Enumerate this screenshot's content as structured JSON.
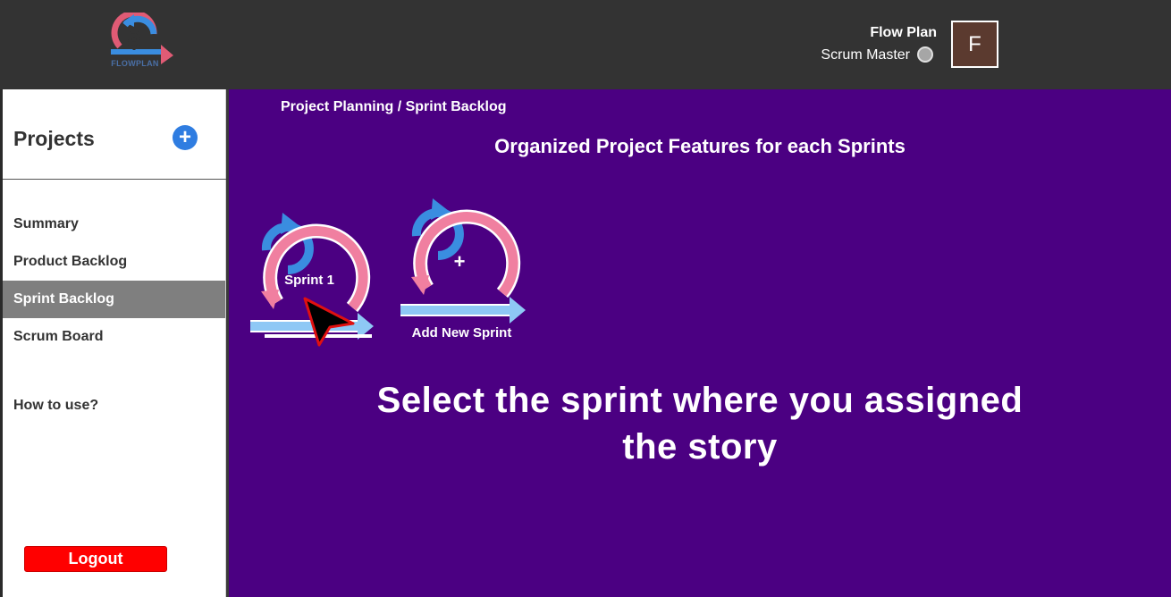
{
  "header": {
    "logo_text": "FLOWPLAN",
    "user_name": "Flow Plan",
    "user_role": "Scrum Master",
    "avatar_letter": "F"
  },
  "sidebar": {
    "title": "Projects",
    "add_label": "+",
    "items": [
      {
        "label": "Summary",
        "active": false
      },
      {
        "label": "Product Backlog",
        "active": false
      },
      {
        "label": "Sprint Backlog",
        "active": true
      },
      {
        "label": "Scrum Board",
        "active": false
      },
      {
        "label": "How to use?",
        "active": false
      }
    ],
    "logout_label": "Logout"
  },
  "main": {
    "breadcrumb": "Project Planning / Sprint Backlog",
    "title": "Organized Project Features for each Sprints",
    "sprints": [
      {
        "label": "Sprint 1"
      }
    ],
    "add_sprint": {
      "symbol": "+",
      "label": "Add New Sprint"
    },
    "caption_line1": "Select the sprint where you assigned",
    "caption_line2": "the story"
  },
  "colors": {
    "header_bg": "#333333",
    "main_bg": "#4b0082",
    "active_nav": "#7f7f7f",
    "logout": "#ff0000",
    "accent_blue": "#2f7de1",
    "sprint_pink": "#f07fa0",
    "sprint_blue": "#3a8de0"
  }
}
